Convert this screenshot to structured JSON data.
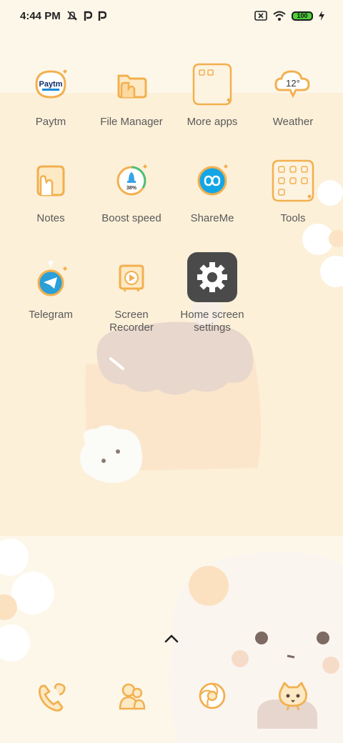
{
  "status_bar": {
    "time": "4:44 PM",
    "notification_icons": [
      "alarm-off-icon",
      "p-app-icon",
      "p-app-icon"
    ],
    "battery_level": "100",
    "system_icons": [
      "sim-x-icon",
      "wifi-icon",
      "battery-icon",
      "charging-icon"
    ]
  },
  "apps": [
    {
      "label": "Paytm",
      "icon": "paytm-icon"
    },
    {
      "label": "File Manager",
      "icon": "folder-icon"
    },
    {
      "label": "More apps",
      "icon": "folder-grid-icon"
    },
    {
      "label": "Weather",
      "icon": "weather-cloud-icon",
      "badge": "12°"
    },
    {
      "label": "Notes",
      "icon": "notes-icon"
    },
    {
      "label": "Boost speed",
      "icon": "rocket-icon",
      "badge": "38%"
    },
    {
      "label": "ShareMe",
      "icon": "shareme-icon"
    },
    {
      "label": "Tools",
      "icon": "tools-folder-icon"
    },
    {
      "label": "Telegram",
      "icon": "telegram-icon"
    },
    {
      "label": "Screen\nRecorder",
      "icon": "screen-recorder-icon"
    },
    {
      "label": "Home screen\nsettings",
      "icon": "gear-icon"
    }
  ],
  "dock": [
    {
      "icon": "phone-icon"
    },
    {
      "icon": "contacts-icon"
    },
    {
      "icon": "browser-icon"
    },
    {
      "icon": "camera-icon"
    }
  ],
  "colors": {
    "icon_stroke": "#f2b04f",
    "icon_fill": "#fde9c4",
    "label": "#5a5a5a",
    "background": "#fdf7ea"
  }
}
